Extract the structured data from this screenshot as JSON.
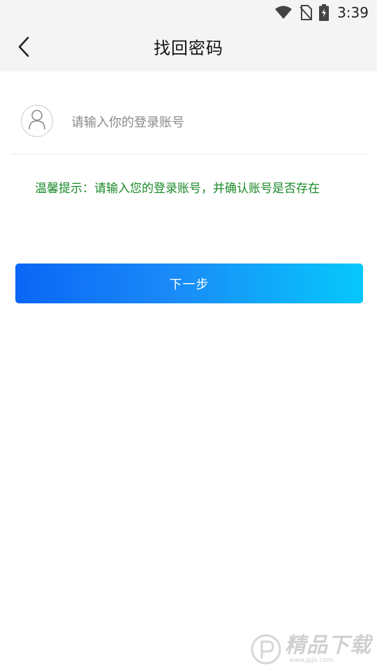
{
  "status_bar": {
    "time": "3:39",
    "icons": [
      "wifi-icon",
      "no-sim-icon",
      "battery-charging-icon"
    ]
  },
  "header": {
    "title": "找回密码",
    "back_icon": "chevron-left-icon"
  },
  "account": {
    "avatar_icon": "user-icon",
    "value": "",
    "placeholder": "请输入你的登录账号"
  },
  "tip": {
    "text": "温馨提示：请输入您的登录账号，并确认账号是否存在"
  },
  "next_button": {
    "label": "下一步"
  },
  "watermark": {
    "brand": "精品下载",
    "url": "www.jpjb.com"
  },
  "colors": {
    "tip": "#1a8a2a",
    "button_gradient_start": "#0a66f6",
    "button_gradient_end": "#06c8fb",
    "header_bg": "#f4f4f4"
  }
}
